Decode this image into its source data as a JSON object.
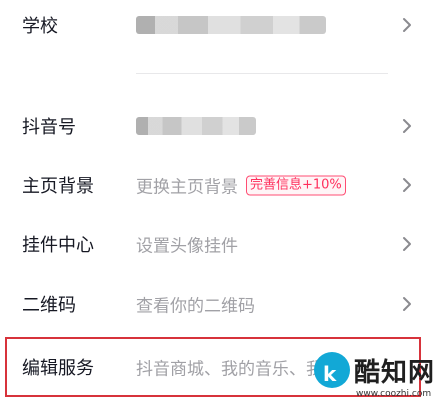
{
  "rows": [
    {
      "label": "学校",
      "value": "",
      "redacted": true
    },
    {
      "label": "抖音号",
      "value": "",
      "redacted": true
    },
    {
      "label": "主页背景",
      "value": "更换主页背景",
      "badge": "完善信息+10%"
    },
    {
      "label": "挂件中心",
      "value": "设置头像挂件"
    },
    {
      "label": "二维码",
      "value": "查看你的二维码"
    },
    {
      "label": "编辑服务",
      "value": "抖音商城、我的音乐、我的"
    }
  ],
  "icons": {
    "row_chevron": "chevron-right-icon"
  },
  "colors": {
    "label": "#161823",
    "value": "#a1a1a6",
    "badge": "#ff2f5c",
    "highlight": "#d7333b",
    "watermark_brand": "#12a8d6"
  },
  "watermark": {
    "title": "酷知网",
    "url": "www.coozhi.com"
  }
}
